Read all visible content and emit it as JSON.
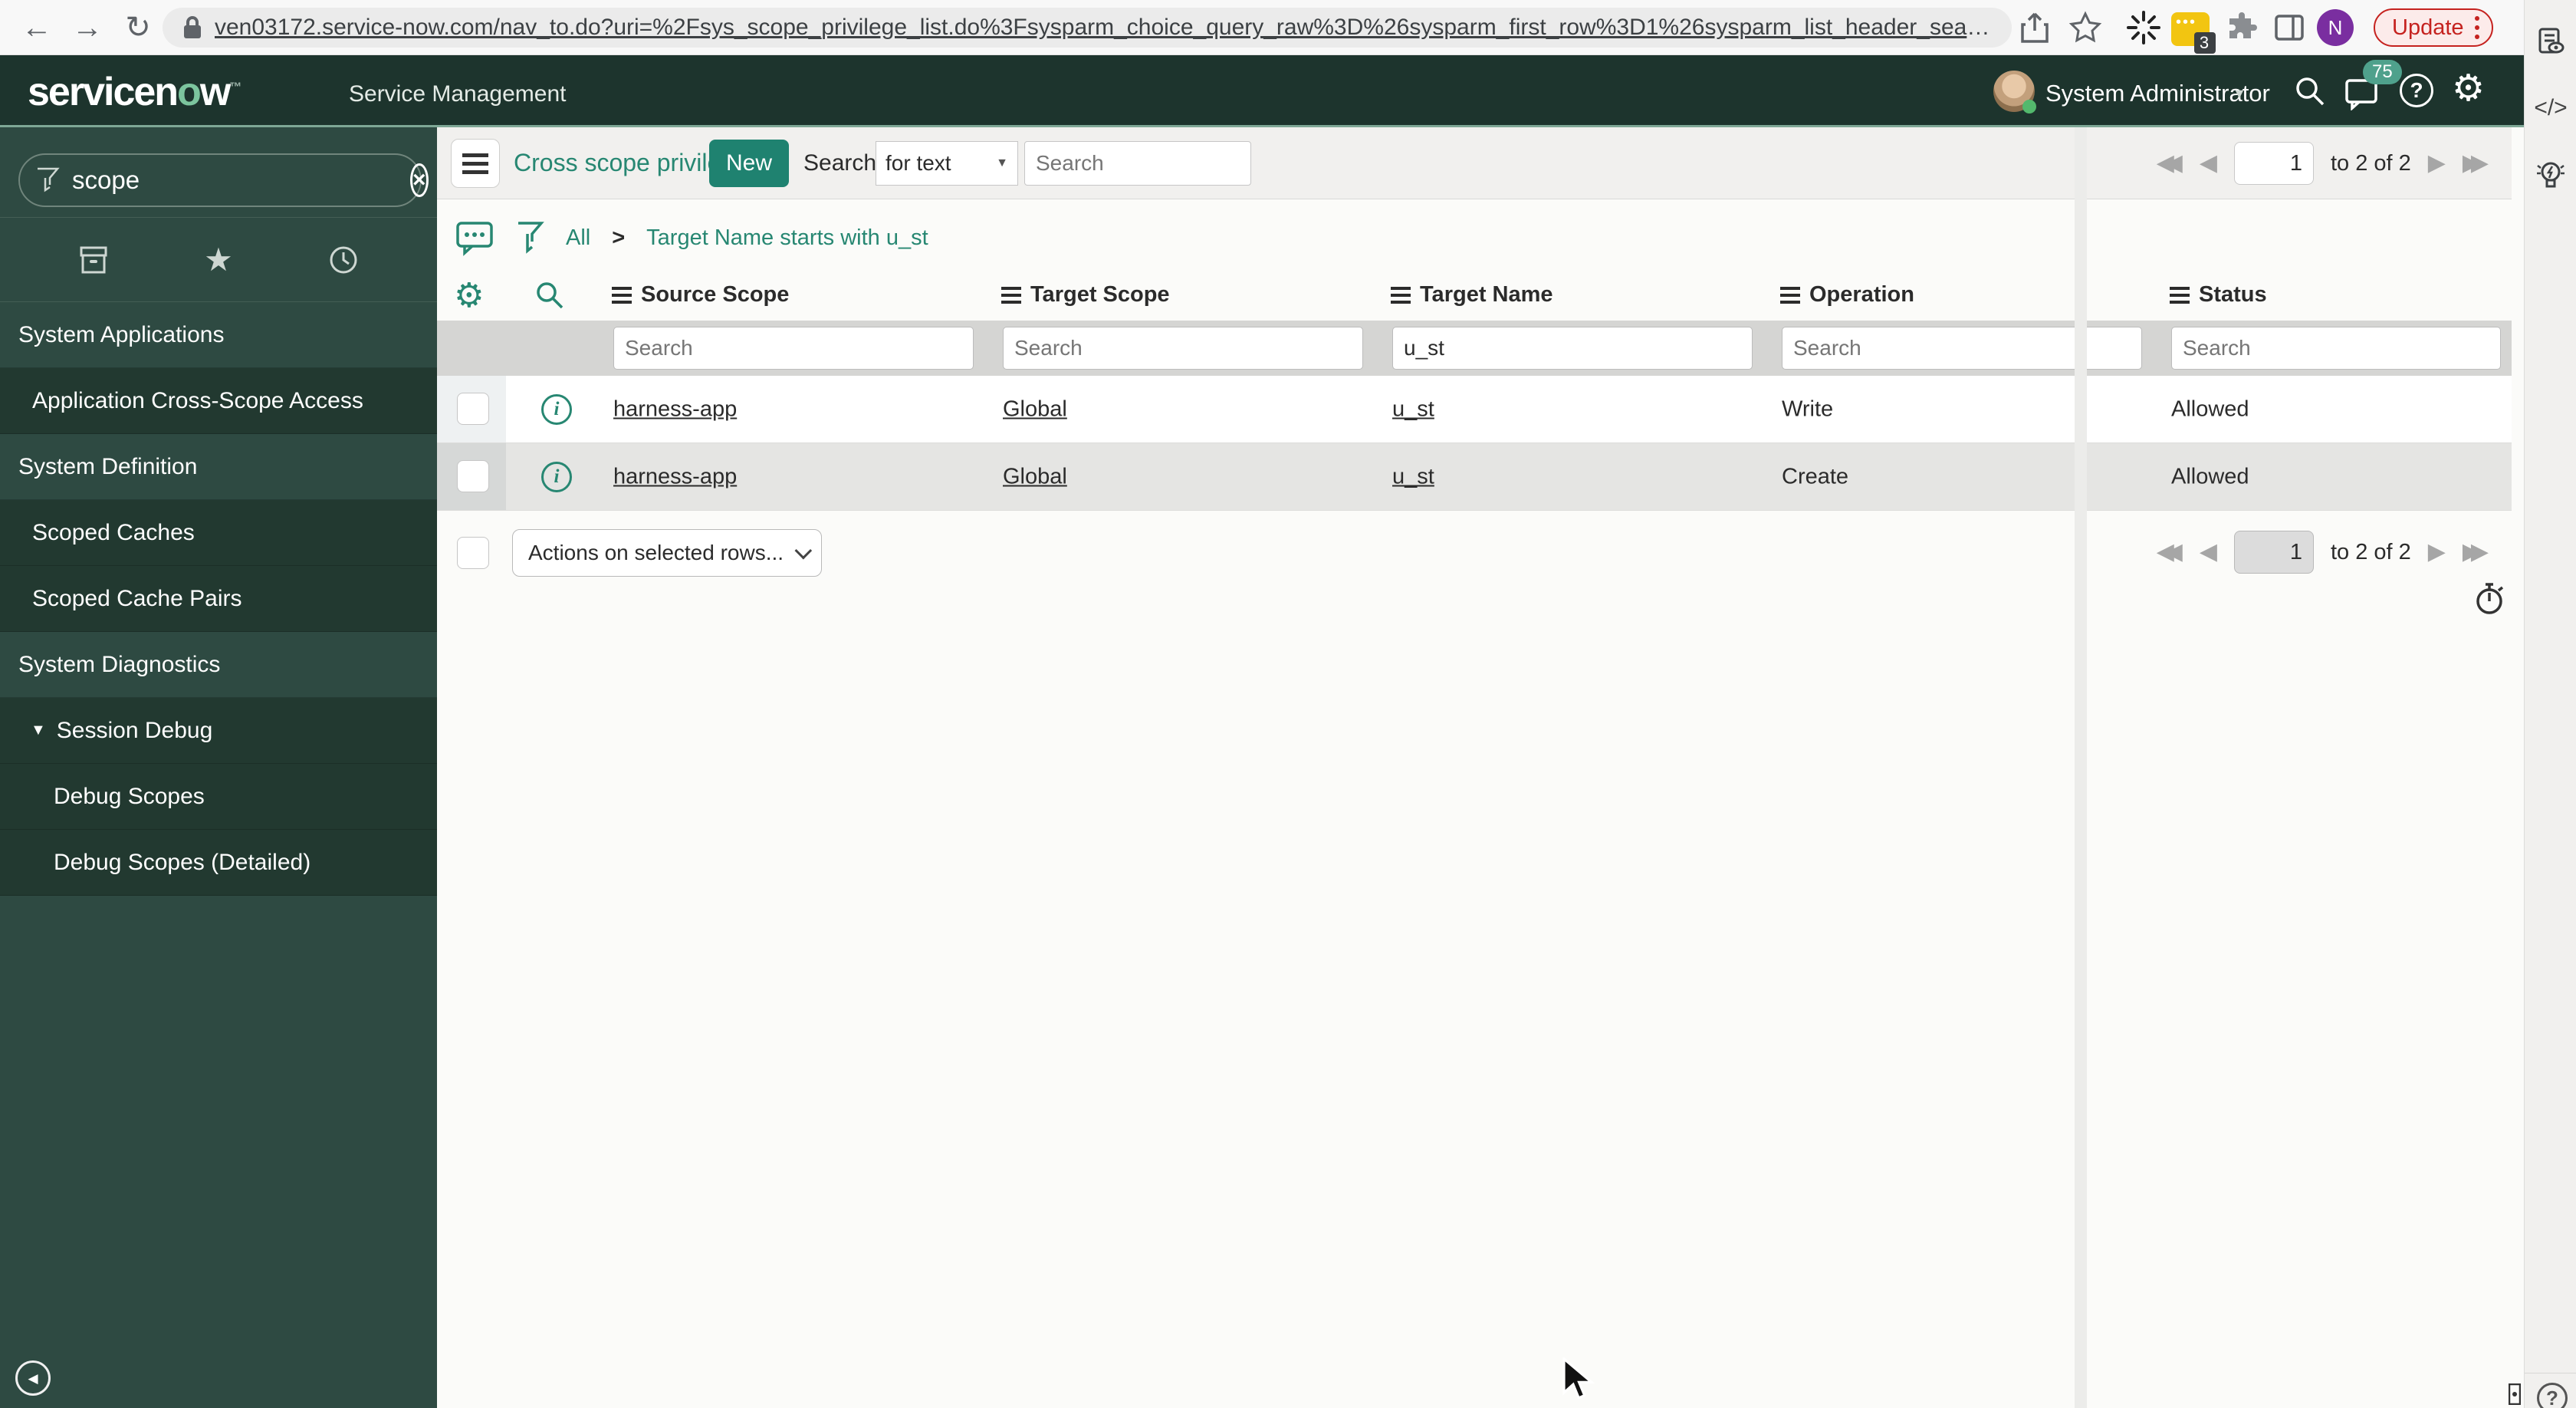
{
  "browser": {
    "url": "ven03172.service-now.com/nav_to.do?uri=%2Fsys_scope_privilege_list.do%3Fsysparm_choice_query_raw%3D%26sysparm_first_row%3D1%26sysparm_list_header_searc...",
    "update_label": "Update",
    "extension_badge": "3",
    "profile_initial": "N",
    "code_icon_label": "</>"
  },
  "header": {
    "logo_pre": "servicen",
    "logo_o": "o",
    "logo_post": "w",
    "logo_tm": "™",
    "product": "Service Management",
    "user": "System Administrator",
    "notification_count": "75",
    "help_glyph": "?",
    "gear_glyph": "⚙"
  },
  "sidebar": {
    "search_value": "scope",
    "clear_glyph": "×",
    "star_glyph": "★",
    "collapse_glyph": "◀",
    "caret_glyph": "▼",
    "items": [
      {
        "label": "System Applications",
        "type": "section"
      },
      {
        "label": "Application Cross-Scope Access",
        "type": "item"
      },
      {
        "label": "System Definition",
        "type": "section"
      },
      {
        "label": "Scoped Caches",
        "type": "item"
      },
      {
        "label": "Scoped Cache Pairs",
        "type": "item"
      },
      {
        "label": "System Diagnostics",
        "type": "section"
      },
      {
        "label": "Session Debug",
        "type": "subsection"
      },
      {
        "label": "Debug Scopes",
        "type": "subitem"
      },
      {
        "label": "Debug Scopes (Detailed)",
        "type": "subitem"
      }
    ]
  },
  "list": {
    "title": "Cross scope privileges",
    "new_button": "New",
    "search_label": "Search",
    "search_type": "for text",
    "search_placeholder": "Search",
    "breadcrumb": {
      "all": "All",
      "sep": ">",
      "filter": "Target Name starts with u_st"
    },
    "columns": [
      "Source Scope",
      "Target Scope",
      "Target Name",
      "Operation",
      "Status"
    ],
    "filters": [
      {
        "placeholder": "Search",
        "value": ""
      },
      {
        "placeholder": "Search",
        "value": ""
      },
      {
        "placeholder": "Search",
        "value": "u_st"
      },
      {
        "placeholder": "Search",
        "value": ""
      },
      {
        "placeholder": "Search",
        "value": ""
      }
    ],
    "rows": [
      {
        "source_scope": "harness-app",
        "target_scope": "Global",
        "target_name": "u_st",
        "operation": "Write",
        "status": "Allowed"
      },
      {
        "source_scope": "harness-app",
        "target_scope": "Global",
        "target_name": "u_st",
        "operation": "Create",
        "status": "Allowed"
      }
    ],
    "actions_label": "Actions on selected rows...",
    "pagination": {
      "page": "1",
      "range": "to 2 of 2"
    },
    "glyphs": {
      "prev": "◀",
      "next": "▶",
      "first": "◀◀",
      "last": "▶▶",
      "caret": "▼"
    }
  },
  "colors": {
    "accent": "#278772",
    "banner": "#1d342d",
    "side": "#2e4a42",
    "side-item": "#223930",
    "badge": "#4fa18c",
    "red": "#c5221f",
    "yellow": "#f2c511",
    "purple": "#7a2ea0"
  }
}
